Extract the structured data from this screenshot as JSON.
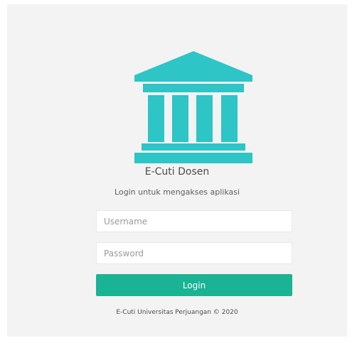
{
  "brand": {
    "logo_icon": "government-building-icon",
    "accent_color": "#2dc5c6",
    "title": "E-Cuti Dosen",
    "subtitle": "Login untuk mengakses aplikasi"
  },
  "form": {
    "username_placeholder": "Username",
    "username_value": "",
    "password_placeholder": "Password",
    "password_value": "",
    "login_label": "Login",
    "login_color": "#1ab394"
  },
  "footer": {
    "text": "E-Cuti Universitas Perjuangan © 2020"
  }
}
